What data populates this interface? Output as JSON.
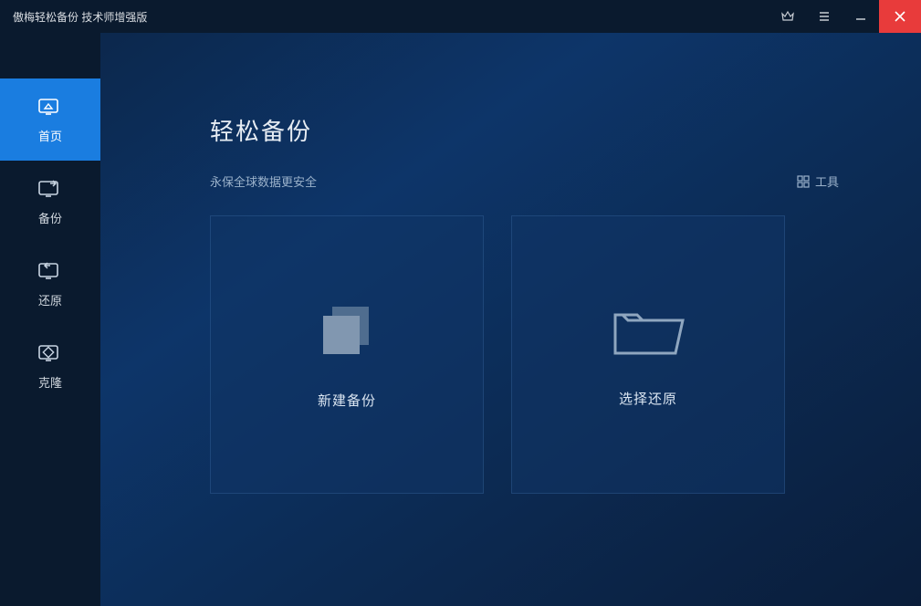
{
  "titlebar": {
    "title": "傲梅轻松备份 技术师增强版"
  },
  "sidebar": {
    "items": [
      {
        "label": "首页"
      },
      {
        "label": "备份"
      },
      {
        "label": "还原"
      },
      {
        "label": "克隆"
      }
    ]
  },
  "main": {
    "title": "轻松备份",
    "subtitle": "永保全球数据更安全",
    "tools_label": "工具",
    "cards": [
      {
        "label": "新建备份"
      },
      {
        "label": "选择还原"
      }
    ]
  }
}
